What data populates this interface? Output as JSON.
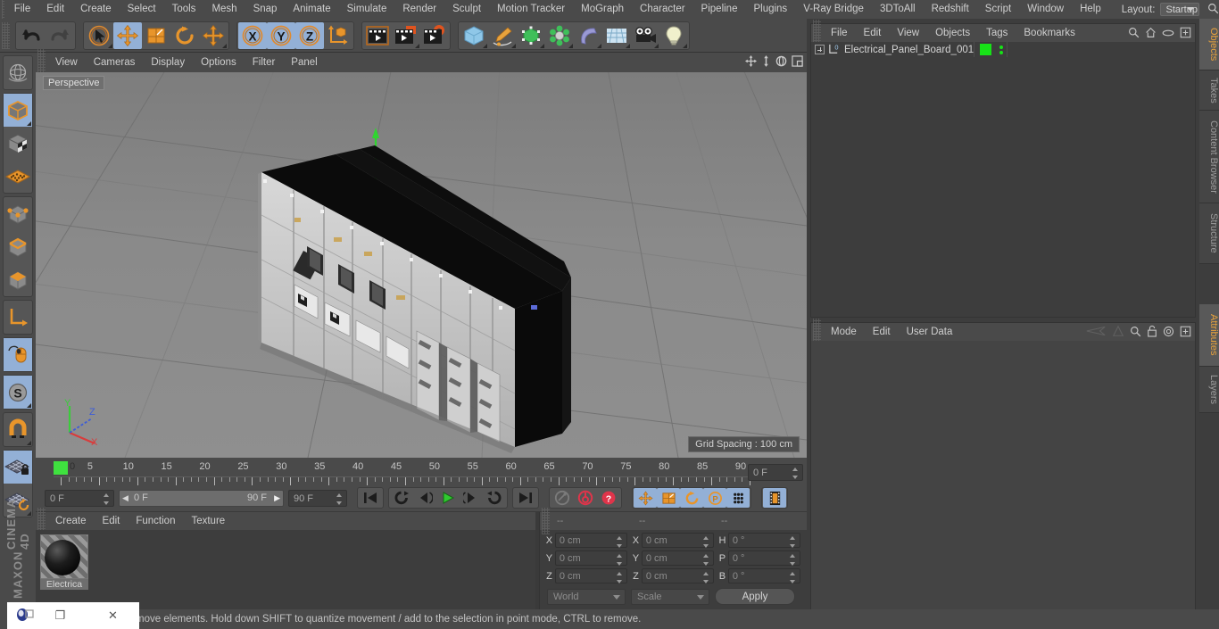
{
  "app": {
    "name": "CINEMA 4D",
    "vendor": "MAXON"
  },
  "menubar": {
    "items": [
      "File",
      "Edit",
      "Create",
      "Select",
      "Tools",
      "Mesh",
      "Snap",
      "Animate",
      "Simulate",
      "Render",
      "Sculpt",
      "Motion Tracker",
      "MoGraph",
      "Character",
      "Pipeline",
      "Plugins",
      "V-Ray Bridge",
      "3DToAll",
      "Redshift",
      "Script",
      "Window",
      "Help"
    ],
    "layout_label": "Layout:",
    "layout_value": "Startup",
    "search_icon": "search-icon"
  },
  "toolbar": {
    "groups": [
      {
        "name": "history",
        "buttons": [
          {
            "icon": "undo-icon",
            "active": false
          },
          {
            "icon": "redo-icon",
            "active": false
          }
        ]
      },
      {
        "name": "transform",
        "buttons": [
          {
            "icon": "live-selection-icon",
            "active": false
          },
          {
            "icon": "move-icon",
            "active": true
          },
          {
            "icon": "scale-icon",
            "active": false
          },
          {
            "icon": "rotate-icon",
            "active": false
          },
          {
            "icon": "move-duplicate-icon",
            "active": false
          }
        ]
      },
      {
        "name": "axis-lock",
        "buttons": [
          {
            "icon": "x-axis-icon",
            "active": true
          },
          {
            "icon": "y-axis-icon",
            "active": true
          },
          {
            "icon": "z-axis-icon",
            "active": true
          },
          {
            "icon": "world-object-axis-icon",
            "active": false
          }
        ]
      },
      {
        "name": "render",
        "buttons": [
          {
            "icon": "render-view-icon",
            "active": false
          },
          {
            "icon": "render-to-picture-viewer-icon",
            "active": false
          },
          {
            "icon": "render-settings-icon",
            "active": false
          }
        ]
      },
      {
        "name": "objects",
        "buttons": [
          {
            "icon": "cube-primitive-icon",
            "active": false
          },
          {
            "icon": "spline-pen-icon",
            "active": false
          },
          {
            "icon": "generator-icon",
            "active": false
          },
          {
            "icon": "deformer-icon",
            "active": false
          },
          {
            "icon": "bend-icon",
            "active": false
          },
          {
            "icon": "floor-environment-icon",
            "active": false
          },
          {
            "icon": "camera-icon",
            "active": false
          },
          {
            "icon": "light-icon",
            "active": false
          }
        ]
      }
    ]
  },
  "left_toolbar": {
    "groups": [
      {
        "buttons": [
          {
            "icon": "undo-view-globe-icon",
            "active": false
          }
        ]
      },
      {
        "buttons": [
          {
            "icon": "model-mode-icon",
            "active": true
          },
          {
            "icon": "texture-mode-icon",
            "active": false
          },
          {
            "icon": "workplane-mode-icon",
            "active": false
          }
        ]
      },
      {
        "buttons": [
          {
            "icon": "points-mode-icon",
            "active": false
          },
          {
            "icon": "edges-mode-icon",
            "active": false
          },
          {
            "icon": "polygons-mode-icon",
            "active": false
          }
        ]
      },
      {
        "buttons": [
          {
            "icon": "axis-modify-icon",
            "active": false
          }
        ]
      },
      {
        "buttons": [
          {
            "icon": "viewport-solo-mouse-icon",
            "active": true
          }
        ]
      },
      {
        "buttons": [
          {
            "icon": "soft-selection-icon",
            "active": true
          }
        ]
      },
      {
        "buttons": [
          {
            "icon": "enable-snap-magnet-icon",
            "active": false
          }
        ]
      },
      {
        "buttons": [
          {
            "icon": "workplane-lock-icon",
            "active": true
          },
          {
            "icon": "workplane-rotate-icon",
            "active": false
          }
        ]
      }
    ]
  },
  "viewport": {
    "menu": [
      "View",
      "Cameras",
      "Display",
      "Options",
      "Filter",
      "Panel"
    ],
    "label": "Perspective",
    "grid_spacing": "Grid Spacing : 100 cm",
    "icons": [
      "pan-icon",
      "dolly-icon",
      "rotate-view-icon",
      "maximize-view-icon"
    ],
    "axis_gizmo": {
      "x": "X",
      "y": "Y",
      "z": "Z",
      "x_color": "#d83c3c",
      "y_color": "#3ccb3c",
      "z_color": "#3c5cd8"
    },
    "scene_object": "Electrical_Panel_Board_001"
  },
  "timeline": {
    "ticks": [
      0,
      5,
      10,
      15,
      20,
      25,
      30,
      35,
      40,
      45,
      50,
      55,
      60,
      65,
      70,
      75,
      80,
      85,
      90
    ],
    "current_frame_marker": "0",
    "fields": {
      "current_frame": "0 F",
      "range_start": "0 F",
      "range_end": "90 F",
      "max_frame": "90 F",
      "end_frame_field": "0 F"
    },
    "transport": [
      {
        "icon": "go-to-start-icon",
        "active": false
      },
      {
        "icon": "play-backwards-loop-icon",
        "active": false
      },
      {
        "icon": "step-back-icon",
        "active": false
      },
      {
        "icon": "play-forward-icon",
        "active": false
      },
      {
        "icon": "step-forward-icon",
        "active": false
      },
      {
        "icon": "play-forward-loop-icon",
        "active": false
      },
      {
        "icon": "go-to-end-icon",
        "active": false
      }
    ],
    "record_group": [
      {
        "icon": "autokeying-icon",
        "active": false
      },
      {
        "icon": "record-active-objects-icon",
        "active": false
      },
      {
        "icon": "keyframe-selection-icon",
        "active": false
      }
    ],
    "key_toggles": [
      {
        "icon": "key-position-icon",
        "active": true
      },
      {
        "icon": "key-scale-icon",
        "active": true
      },
      {
        "icon": "key-rotation-icon",
        "active": true
      },
      {
        "icon": "key-parameter-icon",
        "active": true
      },
      {
        "icon": "key-point-level-icon",
        "active": true
      }
    ],
    "timeline_button": {
      "icon": "timeline-filmstrip-icon",
      "active": true
    }
  },
  "material_manager": {
    "menu": [
      "Create",
      "Edit",
      "Function",
      "Texture"
    ],
    "materials": [
      {
        "name": "Electrica",
        "selected": true
      }
    ]
  },
  "coordinates": {
    "header": [
      "--",
      "--",
      "--"
    ],
    "rows": [
      {
        "pos_label": "X",
        "pos_value": "0 cm",
        "size_label": "X",
        "size_value": "0 cm",
        "rot_label": "H",
        "rot_value": "0 °"
      },
      {
        "pos_label": "Y",
        "pos_value": "0 cm",
        "size_label": "Y",
        "size_value": "0 cm",
        "rot_label": "P",
        "rot_value": "0 °"
      },
      {
        "pos_label": "Z",
        "pos_value": "0 cm",
        "size_label": "Z",
        "size_value": "0 cm",
        "rot_label": "B",
        "rot_value": "0 °"
      }
    ],
    "coord_system": "World",
    "size_mode": "Scale",
    "apply_label": "Apply"
  },
  "object_manager": {
    "menu": [
      "File",
      "Edit",
      "View",
      "Objects",
      "Tags",
      "Bookmarks"
    ],
    "icons": [
      "search-icon",
      "home-icon",
      "ellipse-icon",
      "fit-icon"
    ],
    "objects": [
      {
        "name": "Electrical_Panel_Board_001",
        "visible_dot": true,
        "layer_color": "#17e217"
      }
    ]
  },
  "attribute_manager": {
    "menu": [
      "Mode",
      "Edit",
      "User Data"
    ],
    "icons": [
      "back-history-icon",
      "forward-history-icon",
      "search-icon",
      "lock-icon",
      "target-icon",
      "fit-icon"
    ]
  },
  "right_tabs_top": [
    {
      "label": "Objects",
      "selected": true
    },
    {
      "label": "Takes",
      "selected": false
    },
    {
      "label": "Content Browser",
      "selected": false
    },
    {
      "label": "Structure",
      "selected": false
    }
  ],
  "right_tabs_bottom": [
    {
      "label": "Attributes",
      "selected": true
    },
    {
      "label": "Layers",
      "selected": false
    }
  ],
  "statusbar": {
    "message": "move elements. Hold down SHIFT to quantize movement / add to the selection in point mode, CTRL to remove."
  },
  "window_overlay": {
    "restore_label": "❐",
    "close_label": "✕"
  },
  "colors": {
    "accent_orange": "#e8a33d",
    "panel_bg": "#3d3d3d",
    "bar_bg": "#4a4a4a",
    "active_blue": "#93b0d6",
    "green": "#17e217"
  }
}
